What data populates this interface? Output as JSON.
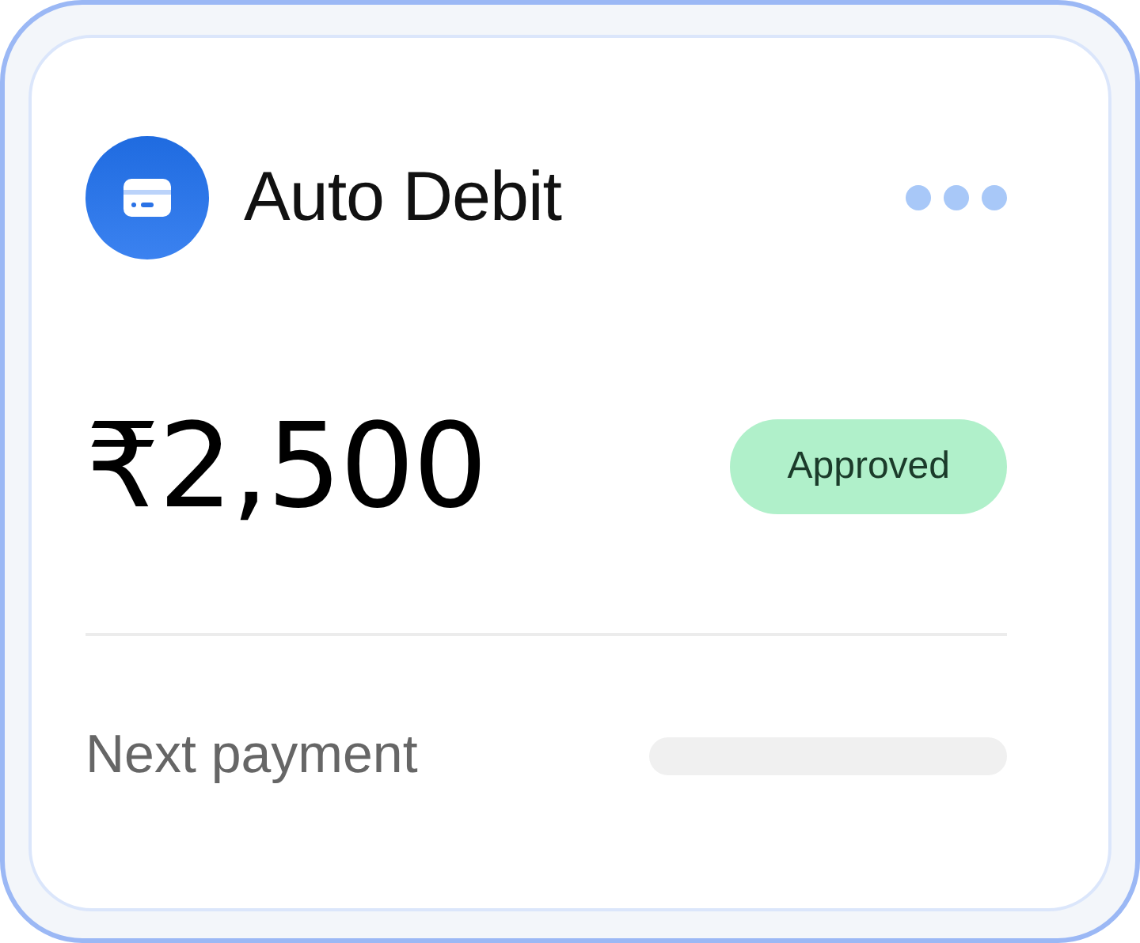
{
  "card": {
    "title": "Auto Debit",
    "amount": "₹2,500",
    "status": {
      "label": "Approved",
      "kind": "approved"
    },
    "next_payment": {
      "label": "Next payment",
      "loading": true
    }
  }
}
